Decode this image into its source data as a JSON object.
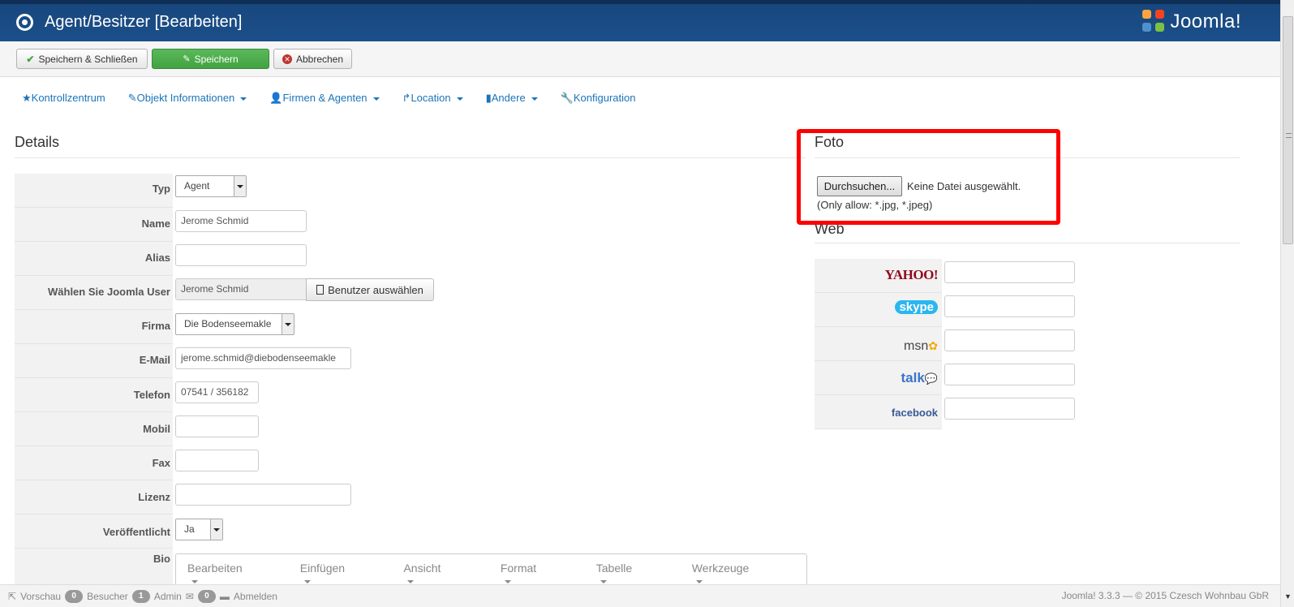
{
  "header": {
    "title": "Agent/Besitzer [Bearbeiten]",
    "brand": "Joomla!"
  },
  "toolbar": {
    "save_close_label": "Speichern & Schließen",
    "save_label": "Speichern",
    "cancel_label": "Abbrechen"
  },
  "nav": {
    "items": [
      {
        "label": "Kontrollzentrum",
        "icon": "star-icon"
      },
      {
        "label": "Objekt Informationen",
        "icon": "edit-icon"
      },
      {
        "label": "Firmen & Agenten",
        "icon": "user-icon"
      },
      {
        "label": "Location",
        "icon": "share-icon"
      },
      {
        "label": "Andere",
        "icon": "bookmark-icon"
      },
      {
        "label": "Konfiguration",
        "icon": "wrench-icon"
      }
    ]
  },
  "details": {
    "heading": "Details",
    "fields": {
      "typ": {
        "label": "Typ",
        "value": "Agent"
      },
      "name": {
        "label": "Name",
        "value": "Jerome Schmid"
      },
      "alias": {
        "label": "Alias",
        "value": ""
      },
      "joomla_user": {
        "label": "Wählen Sie Joomla User",
        "value": "Jerome Schmid",
        "button": "Benutzer auswählen"
      },
      "firma": {
        "label": "Firma",
        "value": "Die Bodenseemakle"
      },
      "email": {
        "label": "E-Mail",
        "value": "jerome.schmid@diebodenseemakle"
      },
      "telefon": {
        "label": "Telefon",
        "value": "07541 / 356182"
      },
      "mobil": {
        "label": "Mobil",
        "value": ""
      },
      "fax": {
        "label": "Fax",
        "value": ""
      },
      "lizenz": {
        "label": "Lizenz",
        "value": ""
      },
      "veroeffentlicht": {
        "label": "Veröffentlicht",
        "value": "Ja"
      },
      "bio": {
        "label": "Bio"
      }
    },
    "editor_menu": [
      "Bearbeiten",
      "Einfügen",
      "Ansicht",
      "Format",
      "Tabelle",
      "Werkzeuge"
    ]
  },
  "foto": {
    "heading": "Foto",
    "browse_label": "Durchsuchen...",
    "no_file": "Keine Datei ausgewählt.",
    "allow_note": "(Only allow: *.jpg, *.jpeg)"
  },
  "web": {
    "heading": "Web",
    "services": [
      {
        "name": "YAHOO!",
        "icon": "yahoo-logo"
      },
      {
        "name": "skype",
        "icon": "skype-logo"
      },
      {
        "name": "msn",
        "icon": "msn-logo"
      },
      {
        "name": "talk",
        "icon": "gtalk-logo"
      },
      {
        "name": "facebook",
        "icon": "facebook-logo"
      }
    ]
  },
  "statusbar": {
    "preview": "Vorschau",
    "visitors_count": "0",
    "visitors_label": "Besucher",
    "admin_count": "1",
    "admin_label": "Admin",
    "messages_count": "0",
    "logout": "Abmelden",
    "footer": "Joomla! 3.3.3 — © 2015 Czesch Wohnbau GbR"
  },
  "colors": {
    "header_bg": "#1c4f8a",
    "save_green": "#46a546",
    "link_blue": "#1a74b8",
    "highlight_red": "#ff0000"
  }
}
